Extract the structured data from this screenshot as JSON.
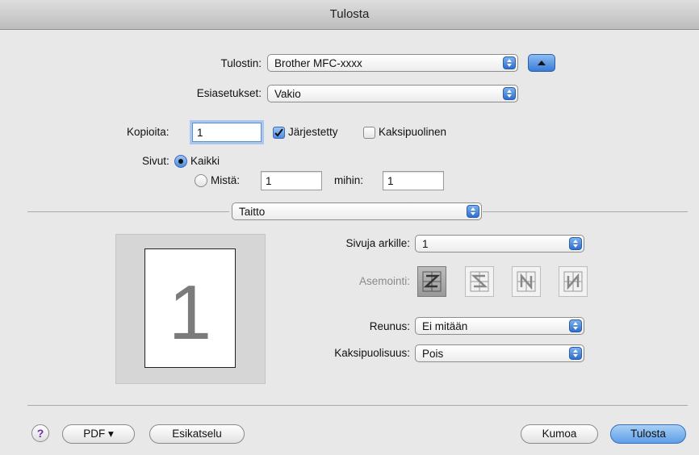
{
  "window": {
    "title": "Tulosta"
  },
  "printer": {
    "label": "Tulostin:",
    "value": "Brother MFC-xxxx"
  },
  "presets": {
    "label": "Esiasetukset:",
    "value": "Vakio"
  },
  "copies": {
    "label": "Kopioita:",
    "value": "1",
    "collated_label": "Järjestetty",
    "collated": true,
    "duplex_label": "Kaksipuolinen",
    "duplex": false
  },
  "pages": {
    "label": "Sivut:",
    "all_label": "Kaikki",
    "from_label": "Mistä:",
    "from_value": "1",
    "to_label": "mihin:",
    "to_value": "1",
    "selected": "all"
  },
  "section": {
    "value": "Taitto"
  },
  "preview": {
    "page_number": "1"
  },
  "layout": {
    "pages_per_sheet_label": "Sivuja arkille:",
    "pages_per_sheet_value": "1",
    "direction_label": "Asemointi:",
    "border_label": "Reunus:",
    "border_value": "Ei mitään",
    "two_sided_label": "Kaksipuolisuus:",
    "two_sided_value": "Pois"
  },
  "footer": {
    "help": "?",
    "pdf_label": "PDF ▾",
    "preview_label": "Esikatselu",
    "cancel_label": "Kumoa",
    "print_label": "Tulosta"
  },
  "colors": {
    "accent": "#4d8ee0",
    "background": "#e8e8e8"
  }
}
